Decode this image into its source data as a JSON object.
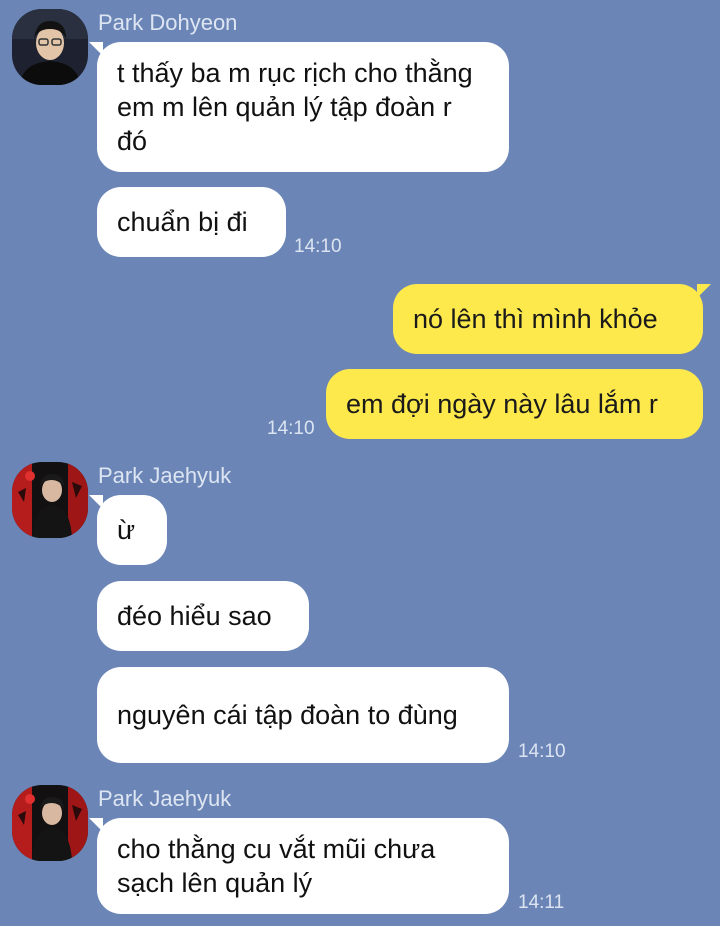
{
  "colors": {
    "background": "#6b86b6",
    "incoming_bubble": "#ffffff",
    "outgoing_bubble": "#fee94c"
  },
  "messages": {
    "g1": {
      "sender": "Park Dohyeon",
      "m1": "t thấy ba m rục rịch cho thằng em m lên quản lý tập đoàn r đó",
      "m2": "chuẩn bị đi",
      "time": "14:10"
    },
    "me": {
      "m1": "nó lên thì mình khỏe",
      "m2": "em đợi ngày này lâu lắm r",
      "time": "14:10"
    },
    "g2": {
      "sender": "Park Jaehyuk",
      "m1": "ừ",
      "m2": "đéo hiểu sao",
      "m3": "nguyên cái tập đoàn to đùng",
      "time": "14:10"
    },
    "g3": {
      "sender": "Park Jaehyuk",
      "m1": "cho thằng cu vắt mũi chưa sạch lên quản lý",
      "time": "14:11"
    }
  }
}
